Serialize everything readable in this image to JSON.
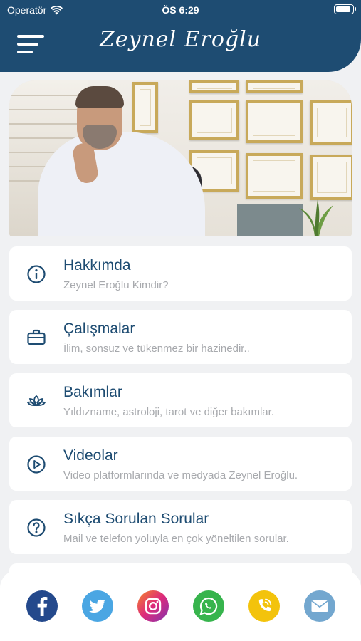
{
  "status_bar": {
    "carrier": "Operatör",
    "time": "ÖS 6:29"
  },
  "header": {
    "title": "Zeynel Eroğlu",
    "menu_icon": "hamburger-menu-icon"
  },
  "menu": {
    "items": [
      {
        "title": "Hakkımda",
        "subtitle": "Zeynel Eroğlu Kimdir?",
        "icon": "info-icon"
      },
      {
        "title": "Çalışmalar",
        "subtitle": "İlim, sonsuz ve tükenmez bir hazinedir..",
        "icon": "briefcase-icon"
      },
      {
        "title": "Bakımlar",
        "subtitle": "Yıldızname, astroloji, tarot ve diğer bakımlar.",
        "icon": "lotus-icon"
      },
      {
        "title": "Videolar",
        "subtitle": "Video platformlarında ve medyada Zeynel Eroğlu.",
        "icon": "play-icon"
      },
      {
        "title": "Sıkça Sorulan Sorular",
        "subtitle": "Mail ve telefon yoluyla en çok yöneltilen sorular.",
        "icon": "question-icon"
      }
    ]
  },
  "footer": {
    "socials": [
      {
        "name": "facebook-icon",
        "color": "#24498c"
      },
      {
        "name": "twitter-icon",
        "color": "#4aa6e3"
      },
      {
        "name": "instagram-icon",
        "color": "#d52b82"
      },
      {
        "name": "whatsapp-icon",
        "color": "#37b44d"
      },
      {
        "name": "phone-icon",
        "color": "#f3c30c"
      },
      {
        "name": "mail-icon",
        "color": "#73a7cf"
      }
    ]
  },
  "colors": {
    "primary": "#1e4c72",
    "background": "#f0f1f3",
    "subtitle": "#a7a9ad"
  }
}
